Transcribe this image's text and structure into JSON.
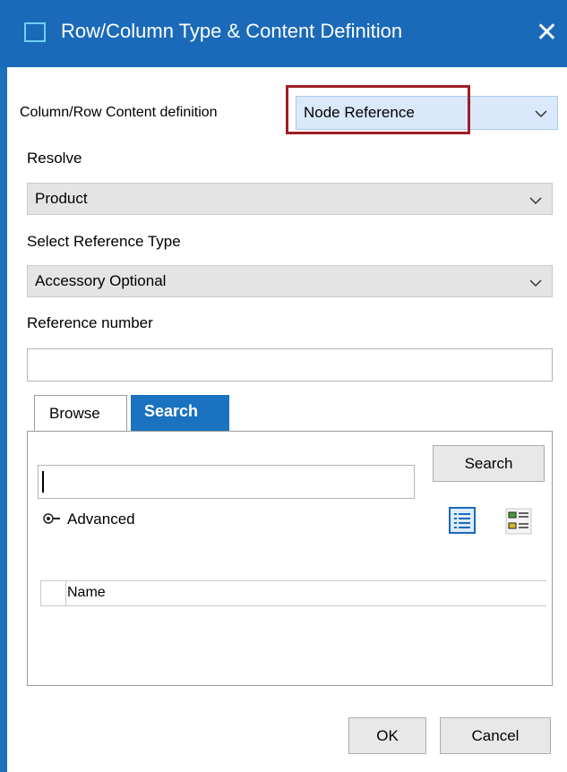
{
  "window": {
    "title": "Row/Column Type & Content Definition",
    "close_glyph": "✕"
  },
  "form": {
    "content_definition_label": "Column/Row Content definition",
    "content_definition_value": "Node Reference",
    "resolve_label": "Resolve",
    "resolve_value": "Product",
    "reference_type_label": "Select Reference Type",
    "reference_type_value": "Accessory Optional",
    "reference_number_label": "Reference number",
    "reference_number_value": ""
  },
  "tabs": [
    {
      "label": "Browse",
      "active": false
    },
    {
      "label": "Search",
      "active": true
    }
  ],
  "search_panel": {
    "query_value": "",
    "search_button": "Search",
    "advanced_label": "Advanced",
    "list_columns": [
      "Name"
    ]
  },
  "footer": {
    "ok_label": "OK",
    "cancel_label": "Cancel"
  },
  "colors": {
    "titlebar": "#1a6ab9",
    "highlight_box": "#a01e25",
    "active_tab": "#1a72c0"
  }
}
